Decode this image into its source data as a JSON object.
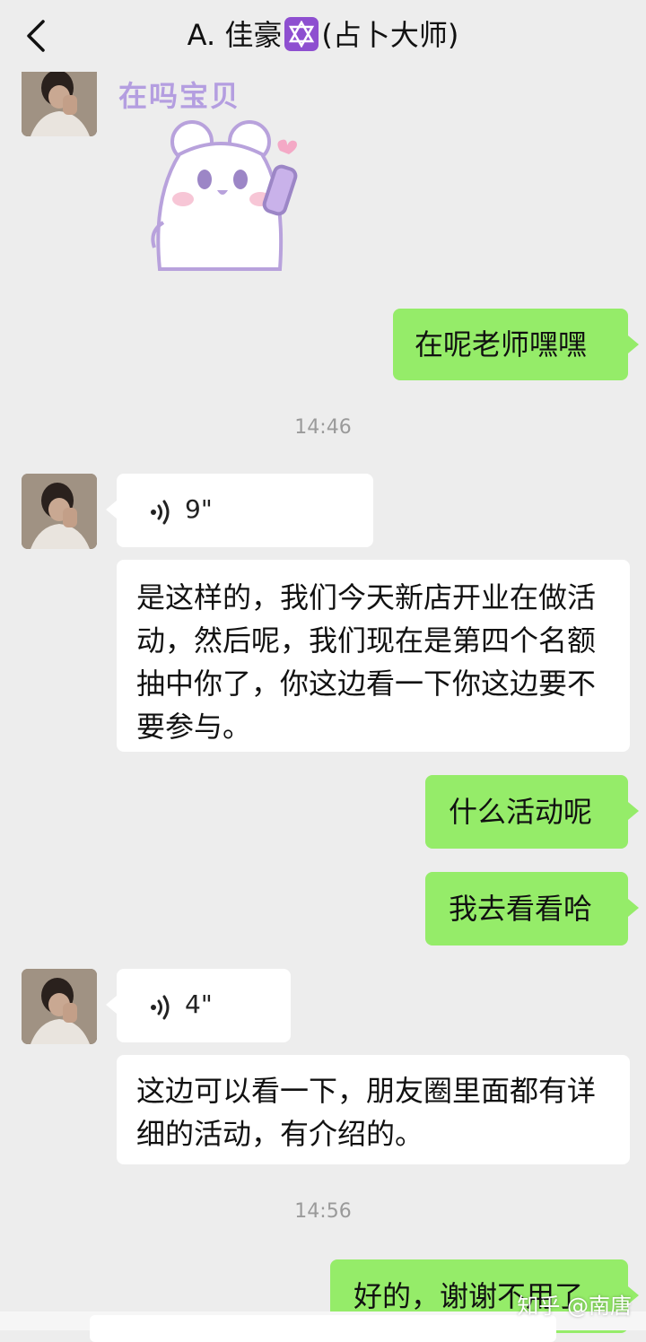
{
  "header": {
    "title_prefix": "A. 佳豪",
    "title_suffix": "(占卜大师)",
    "star_icon": "star-of-david-icon",
    "back_icon": "chevron-left-icon"
  },
  "sticker": {
    "text": "在吗宝贝",
    "icon": "bear-sticker"
  },
  "messages": [
    {
      "text": "在呢老师嘿嘿"
    },
    {
      "time": "14:46"
    },
    {
      "voice_duration": "9\""
    },
    {
      "text": "是这样的，我们今天新店开业在做活动，然后呢，我们现在是第四个名额抽中你了，你这边看一下你这边要不要参与。"
    },
    {
      "text": "什么活动呢"
    },
    {
      "text": "我去看看哈"
    },
    {
      "voice_duration": "4\""
    },
    {
      "text": "这边可以看一下，朋友圈里面都有详细的活动，有介绍的。"
    },
    {
      "time": "14:56"
    },
    {
      "text": "好的，谢谢不用了"
    }
  ],
  "watermark": "知乎 @南唐",
  "colors": {
    "background": "#ededed",
    "outgoing": "#95ec69",
    "incoming": "#ffffff"
  }
}
